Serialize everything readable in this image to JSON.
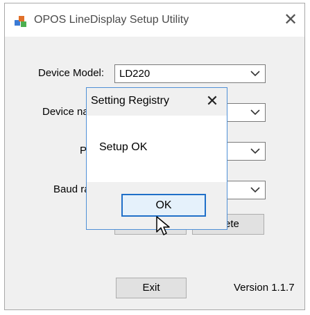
{
  "window": {
    "title": "OPOS LineDisplay Setup Utility",
    "close_glyph": "✕"
  },
  "form": {
    "device_model_label": "Device Model:",
    "device_model_value": "LD220",
    "device_name_label": "Device na",
    "port_label": "P",
    "baud_rate_label": "Baud ra",
    "delete_button_label": "ete",
    "exit_button_label": "Exit",
    "version_text": "Version 1.1.7"
  },
  "dialog": {
    "title": "Setting Registry",
    "message": "Setup OK",
    "ok_label": "OK",
    "close_glyph": "✕"
  },
  "colors": {
    "dialog_border": "#4e8fd6",
    "ok_border": "#1f6fc8",
    "client_bg": "#f0f0f0"
  }
}
